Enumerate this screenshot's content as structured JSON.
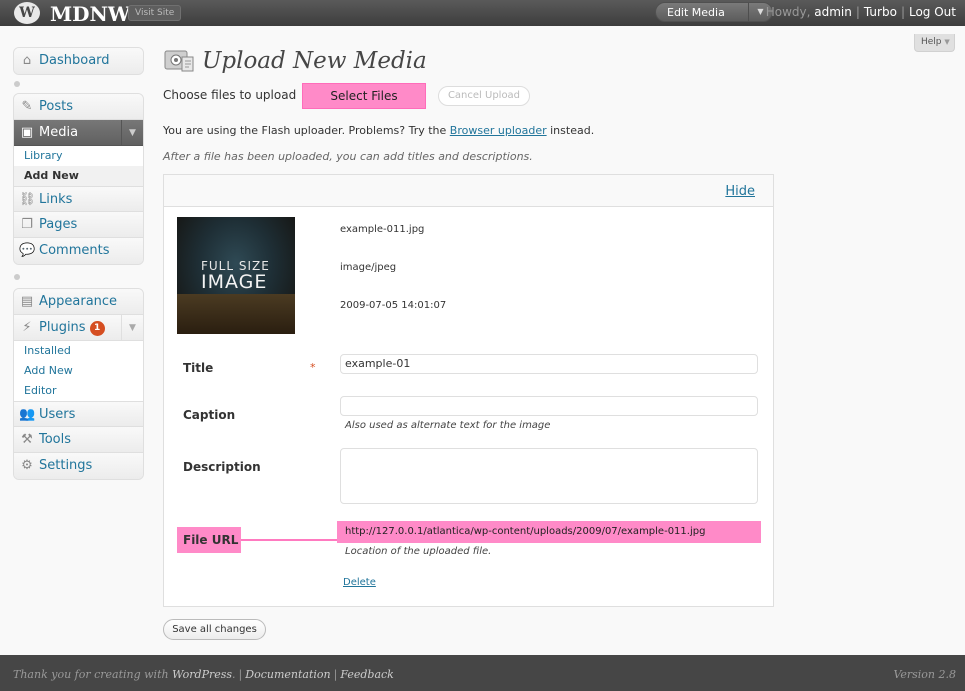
{
  "header": {
    "site_title": "MDNW",
    "visit_site": "Visit Site",
    "favorite_action": "Edit Media",
    "greeting": "Howdy,",
    "username": "admin",
    "turbo": "Turbo",
    "logout": "Log Out"
  },
  "help_tab": "Help",
  "sidebar": {
    "dashboard": "Dashboard",
    "posts": "Posts",
    "media": "Media",
    "media_sub": [
      "Library",
      "Add New"
    ],
    "links": "Links",
    "pages": "Pages",
    "comments": "Comments",
    "appearance": "Appearance",
    "plugins": "Plugins",
    "plugins_badge": "1",
    "plugins_sub": [
      "Installed",
      "Add New",
      "Editor"
    ],
    "users": "Users",
    "tools": "Tools",
    "settings": "Settings"
  },
  "main": {
    "title": "Upload New Media",
    "choose_label": "Choose files to upload",
    "select_files": "Select Files",
    "cancel_upload": "Cancel Upload",
    "flash_msg_pre": "You are using the Flash uploader. Problems? Try the",
    "flash_msg_link": "Browser uploader",
    "flash_msg_post": "instead.",
    "after_msg": "After a file has been uploaded, you can add titles and descriptions."
  },
  "media_item": {
    "hide": "Hide",
    "thumb_line1": "FULL SIZE",
    "thumb_line2": "IMAGE",
    "filename": "example-011.jpg",
    "mime": "image/jpeg",
    "date": "2009-07-05 14:01:07",
    "title_label": "Title",
    "required_mark": "*",
    "title_value": "example-01",
    "caption_label": "Caption",
    "caption_value": "",
    "caption_help": "Also used as alternate text for the image",
    "description_label": "Description",
    "description_value": "",
    "url_label": "File URL",
    "url_value": "http://127.0.0.1/atlantica/wp-content/uploads/2009/07/example-011.jpg",
    "url_help": "Location of the uploaded file.",
    "delete": "Delete"
  },
  "save_all": "Save all changes",
  "footer": {
    "thanks_pre": "Thank you for creating with",
    "wordpress": "WordPress",
    "documentation": "Documentation",
    "feedback": "Feedback",
    "version": "Version 2.8"
  },
  "colors": {
    "header_bg": "#464646",
    "highlight_pink": "#ff8ac8",
    "link_blue": "#21759b"
  }
}
